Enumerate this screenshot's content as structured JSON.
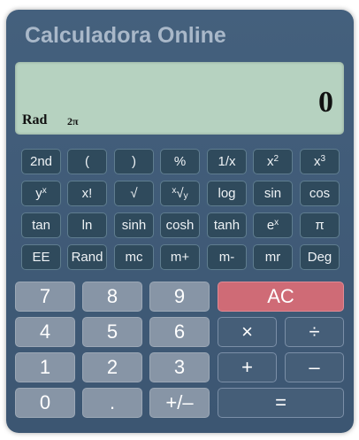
{
  "title": "Calculadora Online",
  "display": {
    "value": "0",
    "mode": "Rad",
    "unit": "2π"
  },
  "sci_rows": [
    [
      "2nd",
      "(",
      ")",
      "%",
      "1/x",
      "x2",
      "x3"
    ],
    [
      "yx",
      "x!",
      "√",
      "x√y",
      "log",
      "sin",
      "cos"
    ],
    [
      "tan",
      "ln",
      "sinh",
      "cosh",
      "tanh",
      "ex",
      "π"
    ],
    [
      "EE",
      "Rand",
      "mc",
      "m+",
      "m-",
      "mr",
      "Deg"
    ]
  ],
  "keys": {
    "seven": "7",
    "eight": "8",
    "nine": "9",
    "four": "4",
    "five": "5",
    "six": "6",
    "one": "1",
    "two": "2",
    "three": "3",
    "zero": "0",
    "decimal": ".",
    "negate": "+/–",
    "clear": "AC",
    "multiply": "×",
    "divide": "÷",
    "add": "+",
    "subtract": "–",
    "equals": "="
  },
  "colors": {
    "body": "#3f5a76",
    "display": "#b6d2c0",
    "clear": "#cf6b76",
    "number": "#8795a6"
  }
}
